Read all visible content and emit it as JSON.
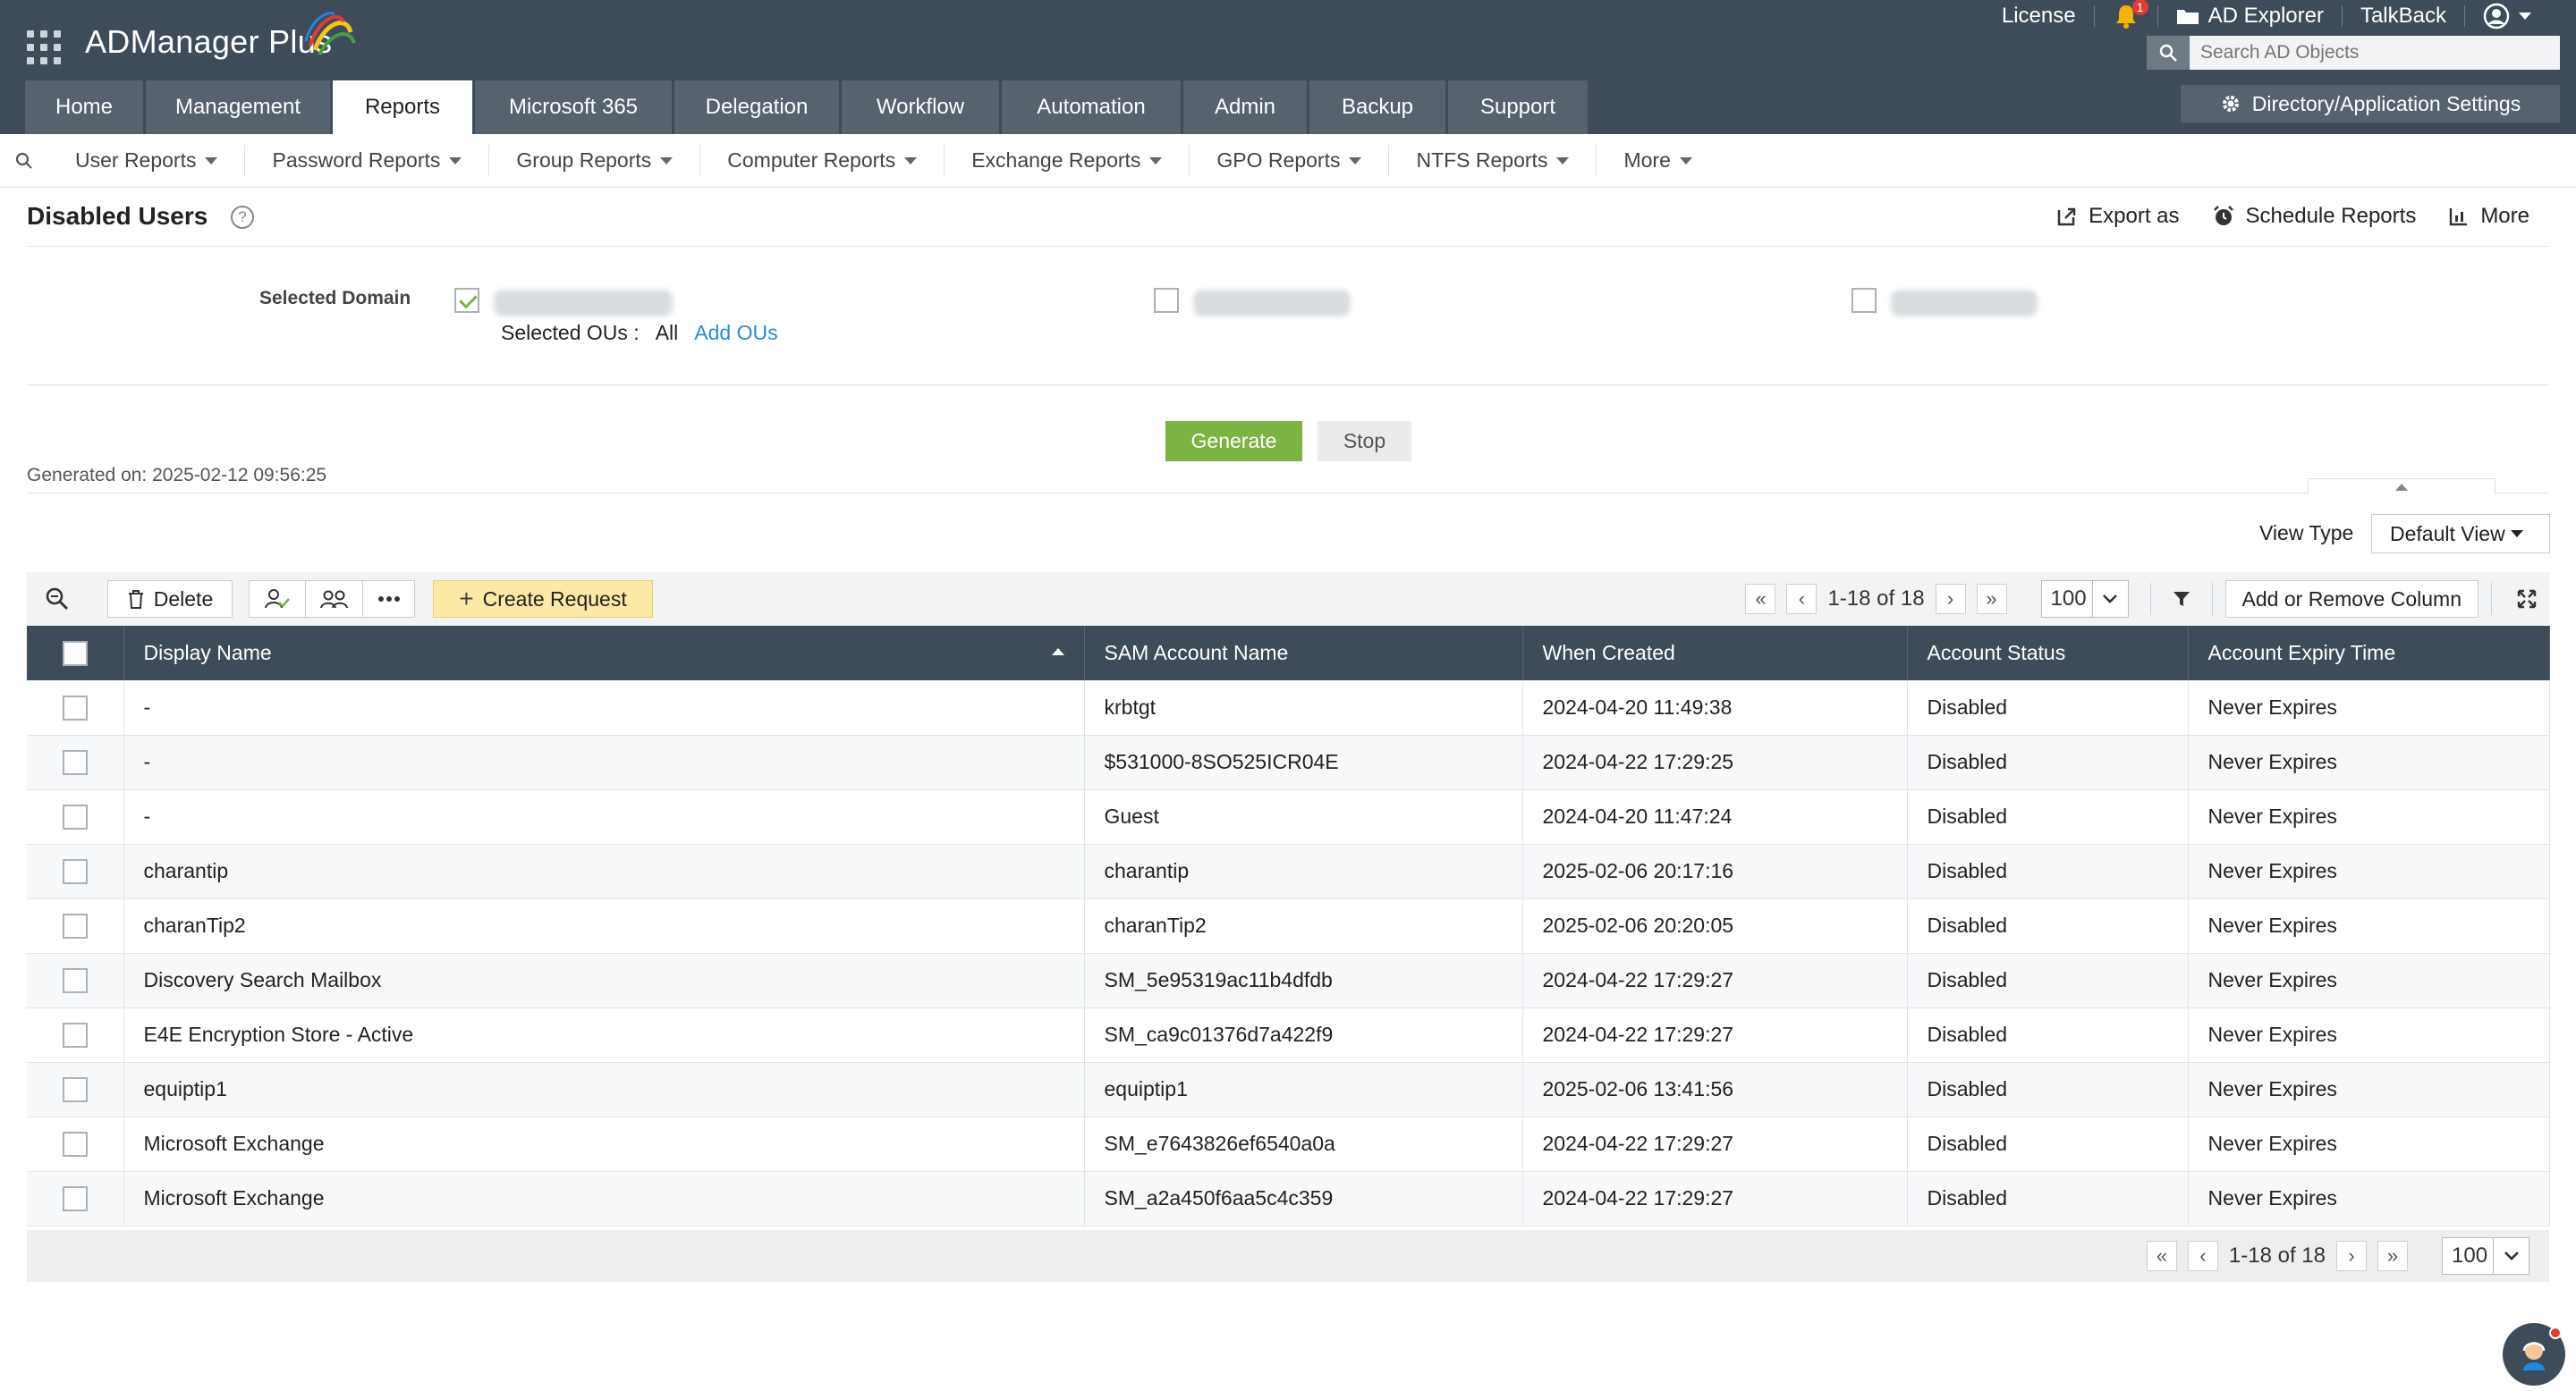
{
  "app": {
    "name": "ADManager Plus",
    "accent": "#7cb342",
    "header_bg": "#3e4c59"
  },
  "top_links": {
    "license": "License",
    "ad_explorer": "AD Explorer",
    "talkback": "TalkBack",
    "notification_count": "1"
  },
  "search": {
    "placeholder": "Search AD Objects"
  },
  "directory_settings": "Directory/Application Settings",
  "main_tabs": [
    {
      "label": "Home"
    },
    {
      "label": "Management"
    },
    {
      "label": "Reports"
    },
    {
      "label": "Microsoft 365"
    },
    {
      "label": "Delegation"
    },
    {
      "label": "Workflow"
    },
    {
      "label": "Automation"
    },
    {
      "label": "Admin"
    },
    {
      "label": "Backup"
    },
    {
      "label": "Support"
    }
  ],
  "active_tab": "Reports",
  "sub_nav": [
    {
      "label": "User Reports"
    },
    {
      "label": "Password Reports"
    },
    {
      "label": "Group Reports"
    },
    {
      "label": "Computer Reports"
    },
    {
      "label": "Exchange Reports"
    },
    {
      "label": "GPO Reports"
    },
    {
      "label": "NTFS Reports"
    },
    {
      "label": "More"
    }
  ],
  "page": {
    "title": "Disabled Users",
    "actions": {
      "export": "Export as",
      "schedule": "Schedule Reports",
      "more": "More"
    }
  },
  "domain": {
    "label": "Selected Domain",
    "selected_ous_label": "Selected OUs :",
    "selected_ous_value": "All",
    "add_ous": "Add OUs"
  },
  "buttons": {
    "generate": "Generate",
    "stop": "Stop"
  },
  "generated_on": "Generated on: 2025-02-12 09:56:25",
  "view_type": {
    "label": "View Type",
    "value": "Default View"
  },
  "toolbar": {
    "delete": "Delete",
    "create_request": "Create Request",
    "pager_text": "1-18 of 18",
    "page_size": "100",
    "add_remove_column": "Add or Remove Column"
  },
  "table": {
    "columns": [
      "Display Name",
      "SAM Account Name",
      "When Created",
      "Account Status",
      "Account Expiry Time"
    ],
    "rows": [
      [
        "-",
        "krbtgt",
        "2024-04-20 11:49:38",
        "Disabled",
        "Never Expires"
      ],
      [
        "-",
        "$531000-8SO525ICR04E",
        "2024-04-22 17:29:25",
        "Disabled",
        "Never Expires"
      ],
      [
        "-",
        "Guest",
        "2024-04-20 11:47:24",
        "Disabled",
        "Never Expires"
      ],
      [
        "charantip",
        "charantip",
        "2025-02-06 20:17:16",
        "Disabled",
        "Never Expires"
      ],
      [
        "charanTip2",
        "charanTip2",
        "2025-02-06 20:20:05",
        "Disabled",
        "Never Expires"
      ],
      [
        "Discovery Search Mailbox",
        "SM_5e95319ac11b4dfdb",
        "2024-04-22 17:29:27",
        "Disabled",
        "Never Expires"
      ],
      [
        "E4E Encryption Store - Active",
        "SM_ca9c01376d7a422f9",
        "2024-04-22 17:29:27",
        "Disabled",
        "Never Expires"
      ],
      [
        "equiptip1",
        "equiptip1",
        "2025-02-06 13:41:56",
        "Disabled",
        "Never Expires"
      ],
      [
        "Microsoft Exchange",
        "SM_e7643826ef6540a0a",
        "2024-04-22 17:29:27",
        "Disabled",
        "Never Expires"
      ],
      [
        "Microsoft Exchange",
        "SM_a2a450f6aa5c4c359",
        "2024-04-22 17:29:27",
        "Disabled",
        "Never Expires"
      ]
    ]
  },
  "footer": {
    "pager_text": "1-18 of 18",
    "page_size": "100"
  }
}
